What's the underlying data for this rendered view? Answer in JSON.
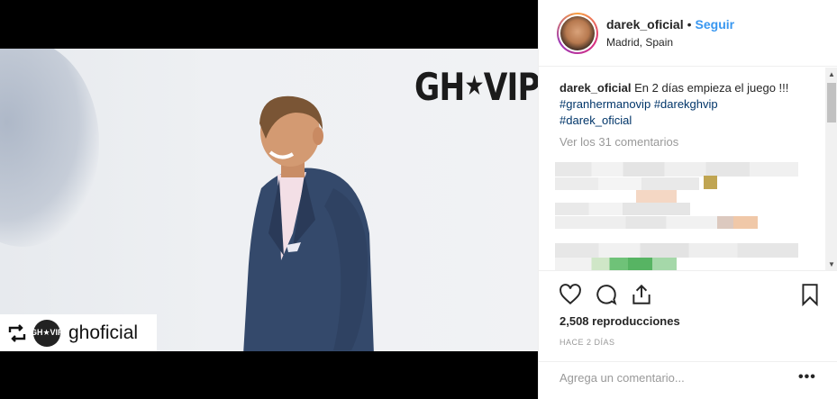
{
  "media": {
    "logo_text": "GH",
    "logo_star": "★",
    "logo_text2": "VIP",
    "repost_avatar_text": "GH★VIP",
    "repost_account": "ghoficial"
  },
  "post": {
    "username": "darek_oficial",
    "separator": "•",
    "follow_label": "Seguir",
    "location": "Madrid, Spain",
    "caption_user": "darek_oficial",
    "caption_text": "En 2 días empieza el juego !!!",
    "hashtags": [
      "#granhermanovip",
      "#darekghvip",
      "#darek_oficial"
    ],
    "view_comments": "Ver los 31 comentarios",
    "plays": "2,508 reproducciones",
    "time_ago": "HACE 2 DÍAS",
    "comment_placeholder": "Agrega un comentario...",
    "more_label": "•••"
  },
  "icons": {
    "like": "heart-icon",
    "comment": "comment-icon",
    "share": "share-icon",
    "save": "bookmark-icon",
    "repost": "repost-icon"
  },
  "colors": {
    "accent": "#3897f0",
    "hashtag": "#003569",
    "muted": "#999999"
  }
}
